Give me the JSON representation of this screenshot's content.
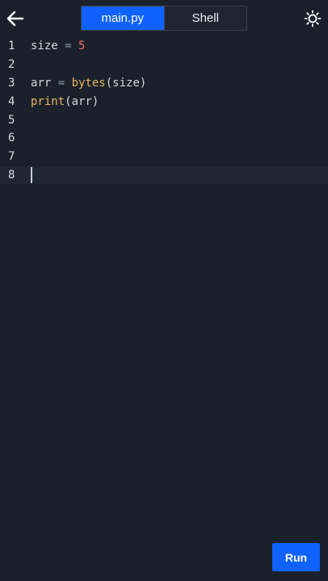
{
  "header": {
    "back_icon": "arrow-left-icon",
    "tabs": [
      {
        "label": "main.py",
        "active": true
      },
      {
        "label": "Shell",
        "active": false
      }
    ],
    "theme_icon": "sun-icon"
  },
  "editor": {
    "lines": [
      {
        "number": "1"
      },
      {
        "number": "2"
      },
      {
        "number": "3"
      },
      {
        "number": "4"
      },
      {
        "number": "5"
      },
      {
        "number": "6"
      },
      {
        "number": "7"
      },
      {
        "number": "8"
      }
    ],
    "code": {
      "line1": {
        "ident": "size",
        "op": " = ",
        "num": "5"
      },
      "line3": {
        "ident": "arr",
        "op": " = ",
        "fn": "bytes",
        "args": "(size)"
      },
      "line4": {
        "fn": "print",
        "args": "(arr)"
      }
    }
  },
  "actions": {
    "run_label": "Run"
  },
  "colors": {
    "background": "#1b212b",
    "accent": "#0f62fe",
    "number": "#f06e6e",
    "function": "#e9b45f"
  }
}
